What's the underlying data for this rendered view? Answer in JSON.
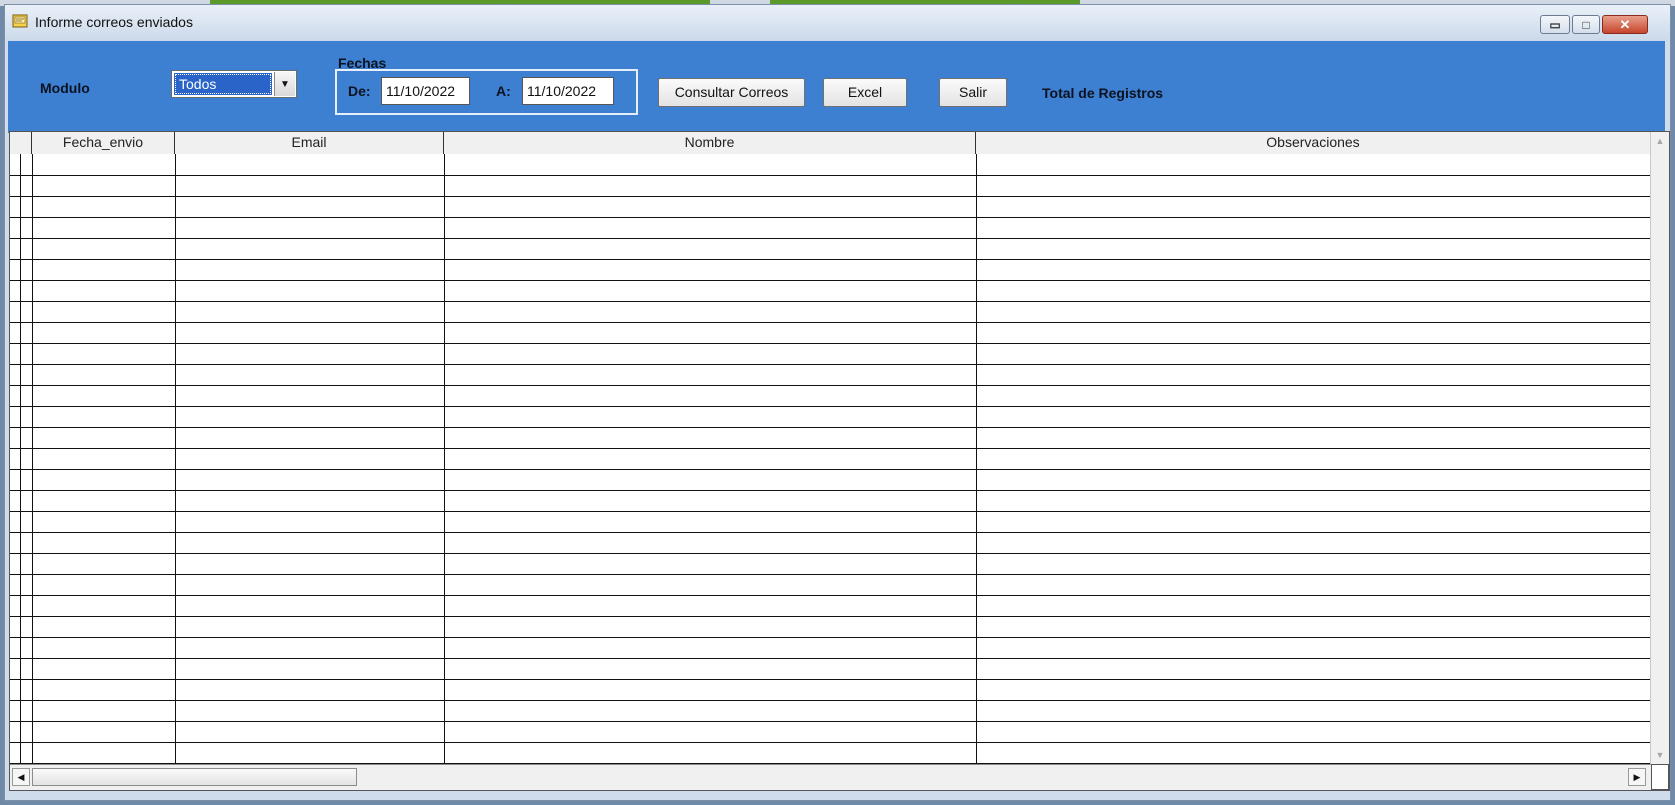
{
  "window": {
    "title": "Informe correos enviados",
    "minimize_icon": "minimize-icon",
    "maximize_icon": "maximize-icon",
    "close_icon": "close-icon"
  },
  "filters": {
    "modulo_label": "Modulo",
    "modulo_value": "Todos",
    "fechas_label": "Fechas",
    "de_label": "De:",
    "de_value": "11/10/2022",
    "a_label": "A:",
    "a_value": "11/10/2022"
  },
  "toolbar": {
    "consultar_label": "Consultar Correos",
    "excel_label": "Excel",
    "salir_label": "Salir",
    "total_label": "Total de Registros"
  },
  "table": {
    "columns": [
      "Fecha_envio",
      "Email",
      "Nombre",
      "Observaciones"
    ],
    "rows": []
  },
  "colors": {
    "panel": "#3d7fd0",
    "selection": "#2a64c8"
  }
}
